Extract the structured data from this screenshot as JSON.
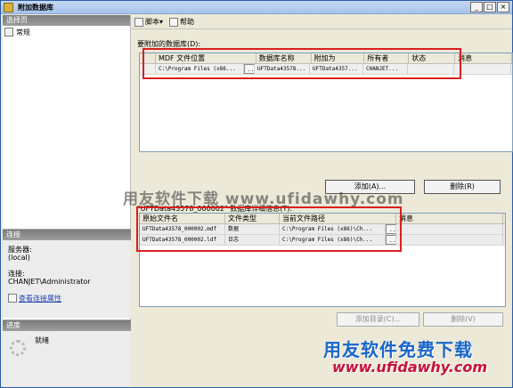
{
  "window": {
    "title": "附加数据库",
    "minimize": "_",
    "maximize": "□",
    "close": "×"
  },
  "sidebar": {
    "section_pages": "选择页",
    "page_general": "常规",
    "section_connection": "连接",
    "server_label": "服务器:",
    "server_value": "(local)",
    "connection_label": "连接:",
    "connection_value": "CHANJET\\Administrator",
    "view_properties": "查看连接属性",
    "section_progress": "进度",
    "progress_status": "就绪"
  },
  "toolbar": {
    "script": "脚本",
    "help": "帮助"
  },
  "attach": {
    "label": "要附加的数据库(D):",
    "headers": [
      "",
      "MDF 文件位置",
      "数据库名称",
      "附加为",
      "所有者",
      "状态",
      "消息"
    ],
    "row": {
      "mdf": "C:\\Program Files (x86...",
      "browse": "...",
      "database": "UFTData43578...",
      "attach_as": "UFTData4357...",
      "owner": "CHANJET...",
      "status": "",
      "message": ""
    }
  },
  "buttons": {
    "add": "添加(A)...",
    "delete": "删除(R)",
    "add_catalog": "添加目录(C)...",
    "delete_catalog": "删除(V)"
  },
  "details": {
    "label": "\"UFTData43578_000002\" 数据库详细信息(T):",
    "headers": [
      "原始文件名",
      "文件类型",
      "当前文件路径",
      "消息"
    ],
    "rows": [
      {
        "name": "UFTData43578_000002.mdf",
        "type": "数据",
        "path": "C:\\Program Files (x86)\\Ch...",
        "browse": "...",
        "message": ""
      },
      {
        "name": "UFTData43578_000002.ldf",
        "type": "日志",
        "path": "C:\\Program Files (x86)\\Ch...",
        "browse": "...",
        "message": ""
      }
    ]
  },
  "watermark": {
    "center": "用友软件下载 www.ufidawhy.com",
    "brand_cn": "用友软件免费下载",
    "brand_url": "www.ufidawhy.com"
  }
}
